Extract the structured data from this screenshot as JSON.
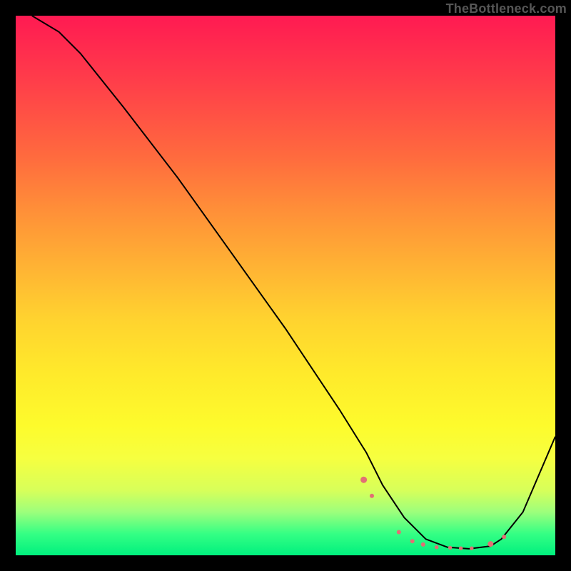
{
  "watermark": "TheBottleneck.com",
  "chart_data": {
    "type": "line",
    "title": "",
    "xlabel": "",
    "ylabel": "",
    "xlim": [
      0,
      100
    ],
    "ylim": [
      0,
      100
    ],
    "series": [
      {
        "name": "curve",
        "x": [
          3,
          8,
          12,
          20,
          30,
          40,
          50,
          60,
          65,
          68,
          72,
          76,
          80,
          84,
          88,
          90,
          94,
          100
        ],
        "y": [
          100,
          97,
          93,
          83,
          70,
          56,
          42,
          27,
          19,
          13,
          7,
          3,
          1.5,
          1.2,
          1.7,
          3,
          8,
          22
        ]
      }
    ],
    "markers": {
      "name": "highlight-dots",
      "x": [
        64.5,
        66,
        71,
        73.5,
        75.5,
        78,
        80.5,
        82.5,
        84.5,
        88,
        90.5
      ],
      "y": [
        14,
        11,
        4.3,
        2.6,
        2.0,
        1.5,
        1.4,
        1.3,
        1.3,
        2.1,
        3.4
      ],
      "r": [
        4.5,
        3.0,
        3.0,
        3.0,
        3.0,
        2.7,
        2.7,
        2.7,
        2.7,
        4.0,
        3.0
      ]
    }
  }
}
